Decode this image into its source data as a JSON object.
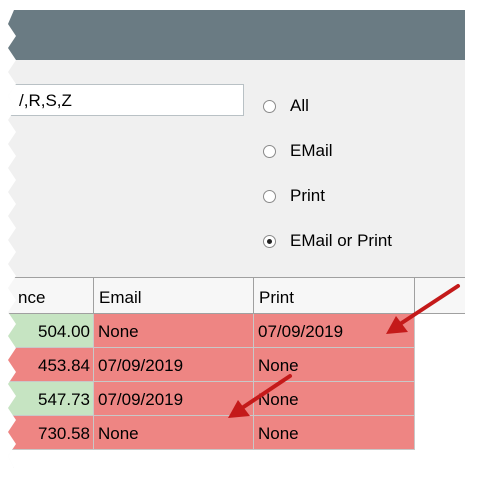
{
  "filter": {
    "value": "/,R,S,Z"
  },
  "delivery": {
    "options": [
      {
        "label": "All",
        "selected": false
      },
      {
        "label": "EMail",
        "selected": false
      },
      {
        "label": "Print",
        "selected": false
      },
      {
        "label": "EMail or Print",
        "selected": true
      }
    ]
  },
  "table": {
    "columns": [
      "nce",
      "Email",
      "Print"
    ],
    "rows": [
      {
        "balance": "504.00",
        "email": "None",
        "print": "07/09/2019"
      },
      {
        "balance": "453.84",
        "email": "07/09/2019",
        "print": "None"
      },
      {
        "balance": "547.73",
        "email": "07/09/2019",
        "print": "None"
      },
      {
        "balance": "730.58",
        "email": "None",
        "print": "None"
      }
    ]
  },
  "colors": {
    "titlebar": "#6a7b83",
    "balance_cell": "#c6e4c2",
    "status_cell": "#ee8583",
    "annotation_arrow": "#c41a1a"
  }
}
